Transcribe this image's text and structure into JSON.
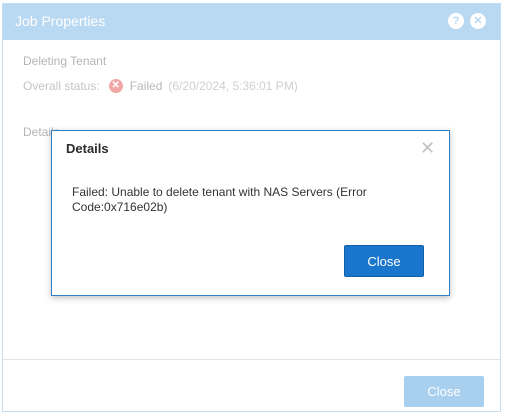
{
  "window": {
    "title": "Job Properties",
    "help_icon": "?",
    "close_icon": "✕"
  },
  "job": {
    "section_title": "Deleting Tenant",
    "status_label": "Overall status:",
    "status_icon": "✕",
    "status_value": "Failed",
    "status_time": "(6/20/2024, 5:36:01 PM)",
    "details_label": "Details"
  },
  "footer": {
    "close_label": "Close"
  },
  "modal": {
    "title": "Details",
    "close_icon": "✕",
    "message": "Failed: Unable to delete tenant with NAS Servers (Error Code:0x716e02b)",
    "close_label": "Close"
  },
  "colors": {
    "titlebar": "#b9d8f1",
    "modal_border": "#2f80c5",
    "primary_button": "#1a76cc",
    "failed_icon": "#f0a7a5"
  }
}
